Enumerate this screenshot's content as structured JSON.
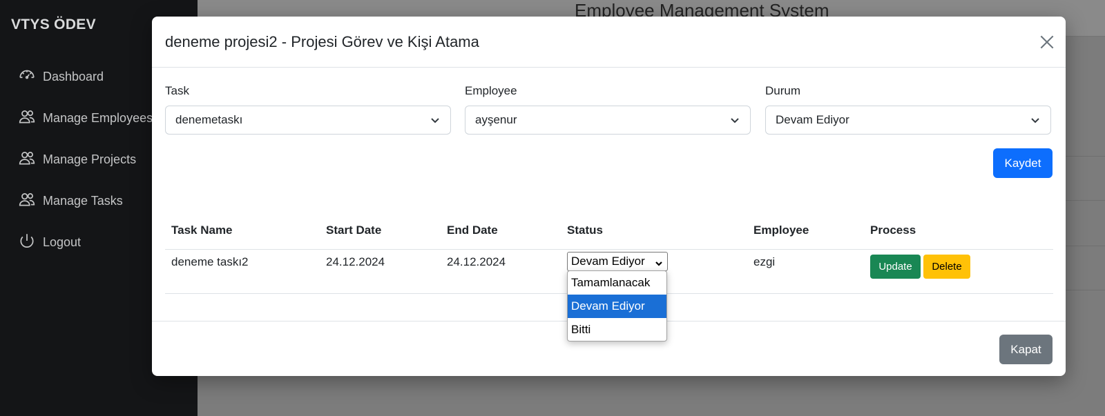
{
  "sidebar": {
    "brand": "VTYS ÖDEV",
    "items": [
      {
        "label": "Dashboard",
        "icon": "dashboard-icon"
      },
      {
        "label": "Manage Employees",
        "icon": "users-icon"
      },
      {
        "label": "Manage Projects",
        "icon": "users-icon"
      },
      {
        "label": "Manage Tasks",
        "icon": "users-icon"
      },
      {
        "label": "Logout",
        "icon": "power-icon"
      }
    ]
  },
  "main": {
    "title": "Employee Management System"
  },
  "modal": {
    "title": "deneme projesi2 - Projesi Görev ve Kişi Atama",
    "form": {
      "task_label": "Task",
      "task_value": "denemetaskı",
      "employee_label": "Employee",
      "employee_value": "ayşenur",
      "status_label": "Durum",
      "status_value": "Devam Ediyor",
      "save_label": "Kaydet"
    },
    "table": {
      "headers": [
        "Task Name",
        "Start Date",
        "End Date",
        "Status",
        "Employee",
        "Process"
      ],
      "rows": [
        {
          "task_name": "deneme taskı2",
          "start_date": "24.12.2024",
          "end_date": "24.12.2024",
          "status": "Devam Ediyor",
          "employee": "ezgi",
          "update_label": "Update",
          "delete_label": "Delete"
        }
      ]
    },
    "status_dropdown": {
      "options": [
        "Tamamlanacak",
        "Devam Ediyor",
        "Bitti"
      ],
      "selected": "Devam Ediyor"
    },
    "close_label": "Kapat"
  },
  "colors": {
    "primary": "#0d6efd",
    "success": "#198754",
    "warning": "#ffc107",
    "secondary": "#6c757d",
    "sidebar_bg": "#141517",
    "dropdown_highlight": "#1a6fd6"
  }
}
